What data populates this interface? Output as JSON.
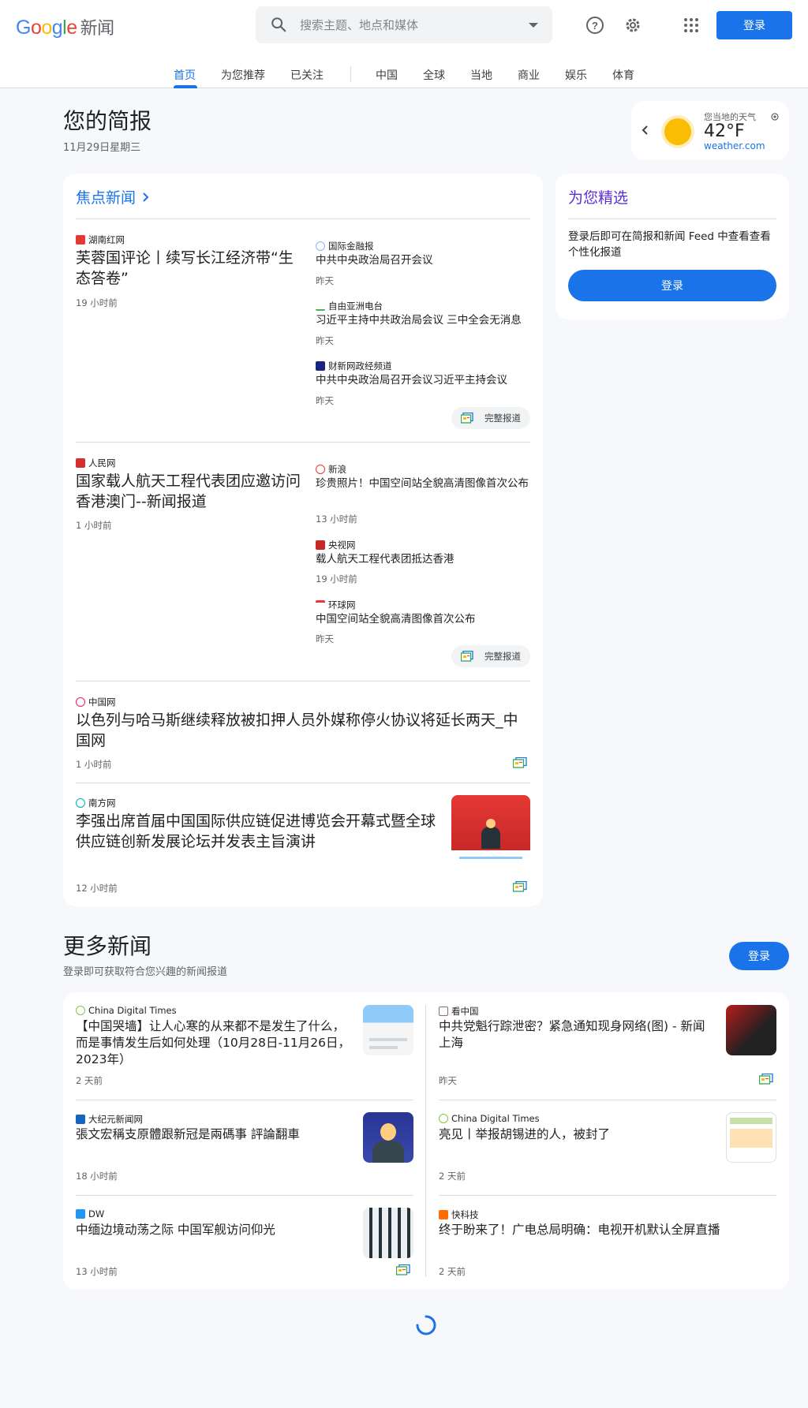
{
  "header": {
    "logo_google": "Google",
    "logo_product": "新闻",
    "search_placeholder": "搜索主题、地点和媒体",
    "signin_label": "登录"
  },
  "nav": {
    "tabs": [
      "首页",
      "为您推荐",
      "已关注",
      "中国",
      "全球",
      "当地",
      "商业",
      "娱乐",
      "体育"
    ],
    "active": "首页"
  },
  "briefing": {
    "title": "您的简报",
    "date": "11月29日星期三"
  },
  "weather": {
    "label": "您当地的天气",
    "temp": "42°F",
    "source": "weather.com"
  },
  "top_stories": {
    "title": "焦点新闻",
    "full_coverage_label": "完整报道",
    "clusters": [
      {
        "main": {
          "source": "湖南红网",
          "title": "芙蓉国评论丨续写长江经济带“生态答卷”",
          "time": "19 小时前"
        },
        "related": [
          {
            "source": "国际金融报",
            "title": "中共中央政治局召开会议",
            "time": "昨天"
          },
          {
            "source": "自由亚洲电台",
            "title": "习近平主持中共政治局会议 三中全会无消息",
            "time": "昨天"
          },
          {
            "source": "财新网政经频道",
            "title": "中共中央政治局召开会议习近平主持会议",
            "time": "昨天"
          }
        ]
      },
      {
        "main": {
          "source": "人民网",
          "title": "国家载人航天工程代表团应邀访问香港澳门--新闻报道",
          "time": "1 小时前"
        },
        "related": [
          {
            "source": "新浪",
            "title": "珍贵照片！中国空间站全貌高清图像首次公布",
            "time": "13 小时前"
          },
          {
            "source": "央视网",
            "title": "载人航天工程代表团抵达香港",
            "time": "19 小时前"
          },
          {
            "source": "环球网",
            "title": "中国空间站全貌高清图像首次公布",
            "time": "昨天"
          }
        ]
      }
    ],
    "single": [
      {
        "source": "中国网",
        "title": "以色列与哈马斯继续释放被扣押人员外媒称停火协议将延长两天_中国网",
        "time": "1 小时前"
      },
      {
        "source": "南方网",
        "title": "李强出席首届中国国际供应链促进博览会开幕式暨全球供应链创新发展论坛并发表主旨演讲",
        "time": "12 小时前"
      }
    ]
  },
  "picks": {
    "title": "为您精选",
    "text": "登录后即可在简报和新闻 Feed 中查看查看个性化报道",
    "button": "登录"
  },
  "more_news": {
    "title": "更多新闻",
    "subtitle": "登录即可获取符合您兴趣的新闻报道",
    "button": "登录",
    "items": [
      {
        "source": "China Digital Times",
        "title": "【中国哭墙】让人心寒的从来都不是发生了什么，而是事情发生后如何处理（10月28日-11月26日，2023年）",
        "time": "2 天前"
      },
      {
        "source": "看中国",
        "title": "中共党魁行踪泄密？紧急通知现身网络(图) - 新闻 上海",
        "time": "昨天"
      },
      {
        "source": "大纪元新闻网",
        "title": "張文宏稱支原體跟新冠是兩碼事 評論翻車",
        "time": "18 小时前"
      },
      {
        "source": "China Digital Times",
        "title": "亮见丨举报胡锡进的人，被封了",
        "time": "2 天前"
      },
      {
        "source": "DW",
        "title": "中缅边境动荡之际 中国军舰访问仰光",
        "time": "13 小时前"
      },
      {
        "source": "快科技",
        "title": "终于盼来了！广电总局明确：电视开机默认全屏直播",
        "time": "2 天前"
      }
    ]
  },
  "colors": {
    "accent": "#1a73e8",
    "picks_title": "#5c2dd5",
    "background": "#f6f8fc"
  }
}
